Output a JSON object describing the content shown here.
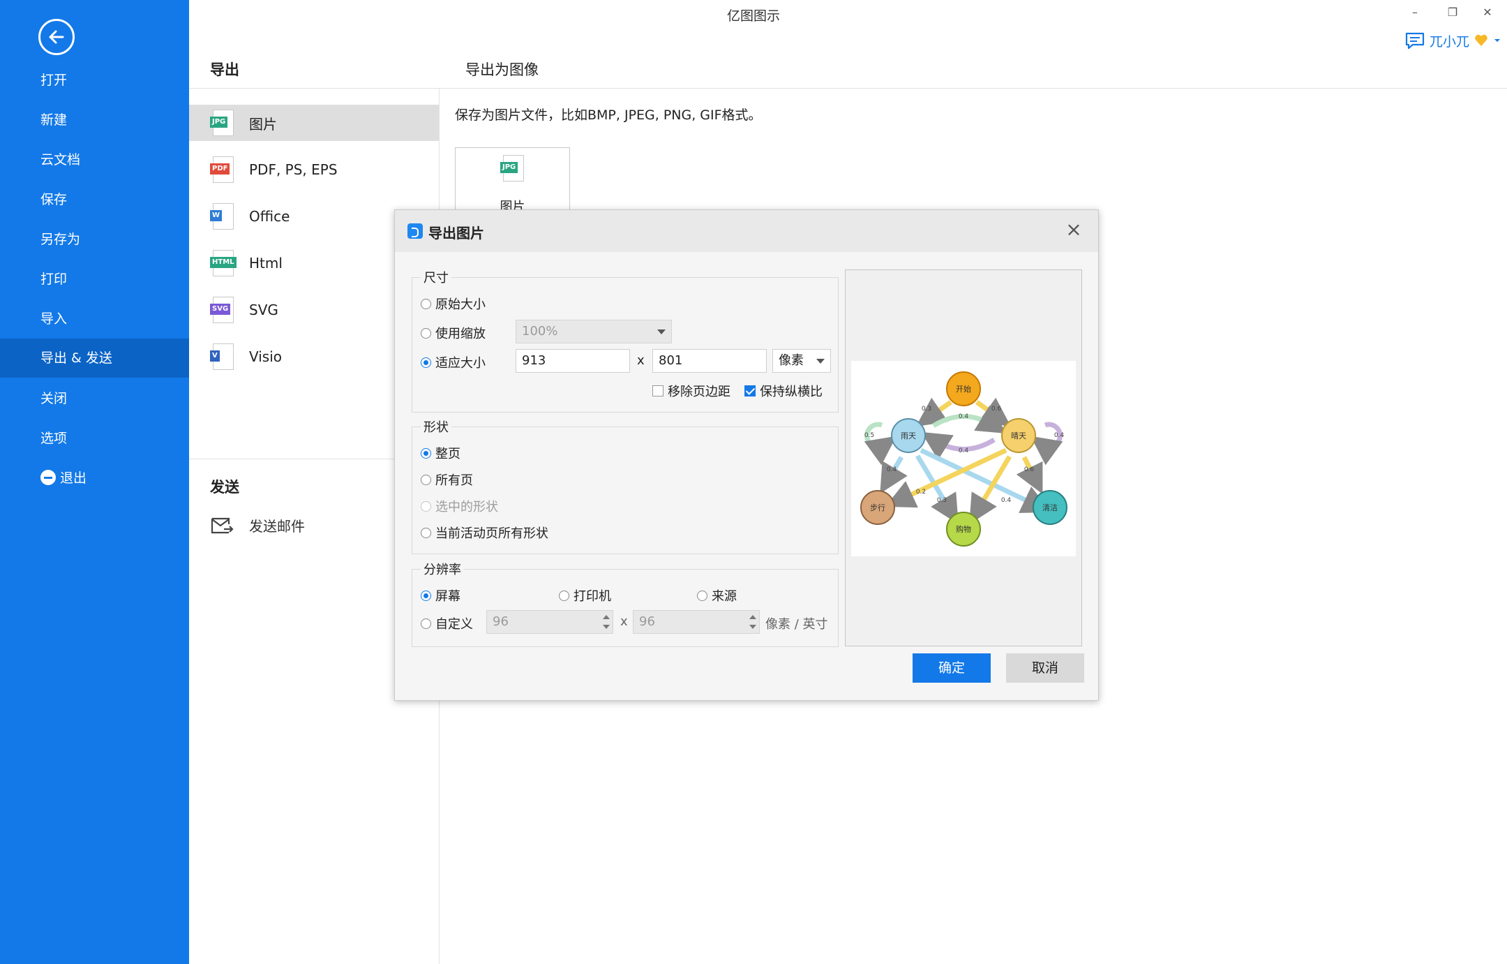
{
  "app": {
    "title": "亿图图示",
    "user_name": "兀小兀"
  },
  "sidebar": {
    "items": [
      {
        "label": "打开"
      },
      {
        "label": "新建"
      },
      {
        "label": "云文档"
      },
      {
        "label": "保存"
      },
      {
        "label": "另存为"
      },
      {
        "label": "打印"
      },
      {
        "label": "导入"
      },
      {
        "label": "导出 & 发送"
      },
      {
        "label": "关闭"
      },
      {
        "label": "选项"
      },
      {
        "label": "退出"
      }
    ],
    "active": "导出 & 发送"
  },
  "export_panel": {
    "header": "导出",
    "formats": [
      {
        "label": "图片",
        "tag": "JPG",
        "tag_color": "#2aa582"
      },
      {
        "label": "PDF, PS, EPS",
        "tag": "PDF",
        "tag_color": "#e04b3c"
      },
      {
        "label": "Office",
        "tag": "W",
        "tag_color": "#2f7cd6"
      },
      {
        "label": "Html",
        "tag": "HTML",
        "tag_color": "#2aa582"
      },
      {
        "label": "SVG",
        "tag": "SVG",
        "tag_color": "#7b58d6"
      },
      {
        "label": "Visio",
        "tag": "V",
        "tag_color": "#2f63c0"
      }
    ],
    "send_header": "发送",
    "send_mail": "发送邮件"
  },
  "content": {
    "header": "导出为图像",
    "description": "保存为图片文件，比如BMP, JPEG, PNG, GIF格式。",
    "tile_label": "图片",
    "tile_tag": "JPG"
  },
  "dialog": {
    "title": "导出图片",
    "size_group": {
      "title": "尺寸",
      "original": "原始大小",
      "use_zoom": "使用缩放",
      "zoom_value": "100%",
      "fit": "适应大小",
      "width": "913",
      "times": "x",
      "height": "801",
      "unit": "像素",
      "remove_margin": "移除页边距",
      "keep_ratio": "保持纵横比",
      "selected": "适应大小"
    },
    "shape_group": {
      "title": "形状",
      "whole_page": "整页",
      "all_pages": "所有页",
      "selected_shapes": "选中的形状",
      "current_page_shapes": "当前活动页所有形状",
      "selected": "整页"
    },
    "resolution_group": {
      "title": "分辨率",
      "screen": "屏幕",
      "printer": "打印机",
      "source": "来源",
      "custom": "自定义",
      "dpi_x": "96",
      "times": "x",
      "dpi_y": "96",
      "unit": "像素 / 英寸",
      "selected": "屏幕"
    },
    "ok": "确定",
    "cancel": "取消",
    "preview": {
      "nodes": [
        "开始",
        "雨天",
        "晴天",
        "步行",
        "购物",
        "清洁"
      ],
      "edge_labels": [
        "0.3",
        "0.4",
        "0.6",
        "0.4",
        "0.5",
        "0.4",
        "0.4",
        "0.6",
        "0.2",
        "0.3",
        "0.4"
      ]
    }
  }
}
